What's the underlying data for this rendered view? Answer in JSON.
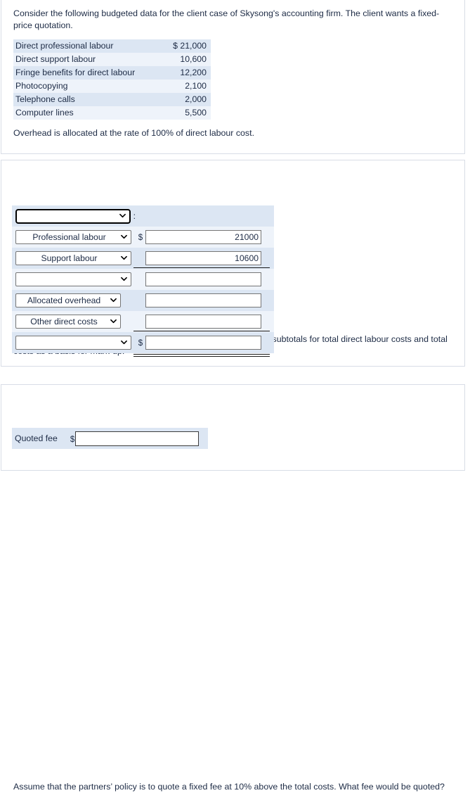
{
  "question_1": {
    "prompt": "Consider the following budgeted data for the client case of Skysong's accounting firm. The client wants a fixed-price quotation.",
    "table": {
      "rows": [
        {
          "label": "Direct professional labour",
          "amount": "$ 21,000"
        },
        {
          "label": "Direct support labour",
          "amount": "10,600"
        },
        {
          "label": "Fringe benefits for direct labour",
          "amount": "12,200"
        },
        {
          "label": "Photocopying",
          "amount": "2,100"
        },
        {
          "label": "Telephone calls",
          "amount": "2,000"
        },
        {
          "label": "Computer lines",
          "amount": "5,500"
        }
      ]
    },
    "note": "Overhead is allocated at the rate of 100% of direct labour cost."
  },
  "question_2": {
    "prompt": "Prepare a schedule of the budgeted total costs for the client. Show subtotals for total direct labour costs and total costs as a basis for mark-up.",
    "schedule_rows": [
      {
        "select_value": "",
        "colon": ":",
        "dollar": "",
        "amount": "",
        "has_amount_input": false
      },
      {
        "select_value": "Professional labour",
        "colon": "",
        "dollar": "$",
        "amount": "21000",
        "has_amount_input": true
      },
      {
        "select_value": "Support labour",
        "colon": "",
        "dollar": "",
        "amount": "10600",
        "has_amount_input": true
      },
      {
        "select_value": "",
        "colon": "",
        "dollar": "",
        "amount": "",
        "has_amount_input": true
      },
      {
        "select_value": "Allocated overhead",
        "colon": "",
        "dollar": "",
        "amount": "",
        "has_amount_input": true
      },
      {
        "select_value": "Other direct costs",
        "colon": "",
        "dollar": "",
        "amount": "",
        "has_amount_input": true
      },
      {
        "select_value": "",
        "colon": "",
        "dollar": "$",
        "amount": "",
        "has_amount_input": true
      }
    ]
  },
  "question_3": {
    "prompt": "Assume that the partners’ policy is to quote a fixed fee at 10% above the total costs. What fee would be quoted?",
    "quoted_fee_label": "Quoted fee",
    "quoted_fee_dollar": "$",
    "quoted_fee_value": ""
  },
  "colors": {
    "band_dark": "#dce6f3",
    "band_light": "#eef3fa",
    "panel_border": "#d8dde6",
    "text": "#1d2b45"
  }
}
